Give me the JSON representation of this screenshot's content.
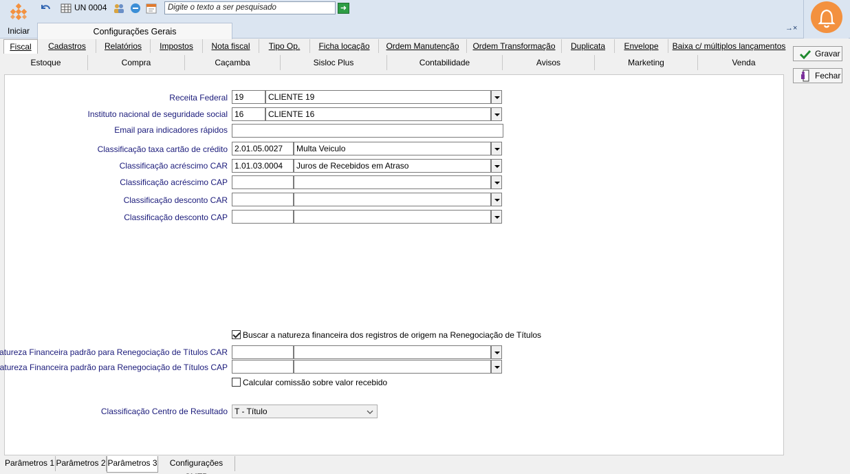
{
  "toolbar": {
    "start_label": "Iniciar",
    "unit_label": "UN 0004",
    "search_placeholder": "Digite o texto a ser pesquisado",
    "doc_tab": "Configurações Gerais",
    "close_ctl": "→×"
  },
  "tabs_row1": [
    "Fiscal",
    "Cadastros",
    "Relatórios",
    "Impostos",
    "Nota fiscal",
    "Tipo Op.",
    "Ficha locação",
    "Ordem Manutenção",
    "Ordem Transformação",
    "Duplicata",
    "Envelope",
    "Baixa c/ múltiplos lançamentos"
  ],
  "tabs_row2": [
    "Estoque",
    "Compra",
    "Caçamba",
    "Sisloc Plus",
    "Contabilidade",
    "Avisos",
    "Marketing",
    "Venda"
  ],
  "actions": {
    "save": "Gravar",
    "close": "Fechar"
  },
  "fields": {
    "receita": {
      "label": "Receita Federal",
      "code": "19",
      "desc": "CLIENTE  19"
    },
    "inss": {
      "label": "Instituto nacional de seguridade social",
      "code": "16",
      "desc": "CLIENTE  16"
    },
    "email": {
      "label": "Email para indicadores rápidos",
      "value": ""
    },
    "taxa_cartao": {
      "label": "Classificação taxa cartão de crédito",
      "code": "2.01.05.0027",
      "desc": "Multa Veiculo"
    },
    "acresc_car": {
      "label": "Classificação acréscimo CAR",
      "code": "1.01.03.0004",
      "desc": "Juros de Recebidos em Atraso"
    },
    "acresc_cap": {
      "label": "Classificação acréscimo CAP",
      "code": "",
      "desc": ""
    },
    "desc_car": {
      "label": "Classificação desconto CAR",
      "code": "",
      "desc": ""
    },
    "desc_cap": {
      "label": "Classificação desconto CAP",
      "code": "",
      "desc": ""
    },
    "buscar_natureza": {
      "label": "Buscar a natureza financeira dos registros de origem na Renegociação de Títulos",
      "checked": true
    },
    "nat_car": {
      "label": "Natureza Financeira padrão para Renegociação de Títulos CAR",
      "code": "",
      "desc": ""
    },
    "nat_cap": {
      "label": "Natureza Financeira padrão para Renegociação de Títulos CAP",
      "code": "",
      "desc": ""
    },
    "comissao": {
      "label": "Calcular comissão sobre valor recebido",
      "checked": false
    },
    "centro_resultado": {
      "label": "Classificação Centro de Resultado",
      "value": "T - Título"
    }
  },
  "bottom_tabs": [
    "Parâmetros 1",
    "Parâmetros 2",
    "Parâmetros 3",
    "Configurações SMTP"
  ],
  "colors": {
    "accent_orange": "#f3913f",
    "label_navy": "#1a1a7a",
    "toolbar_bg": "#dbe5f1"
  }
}
